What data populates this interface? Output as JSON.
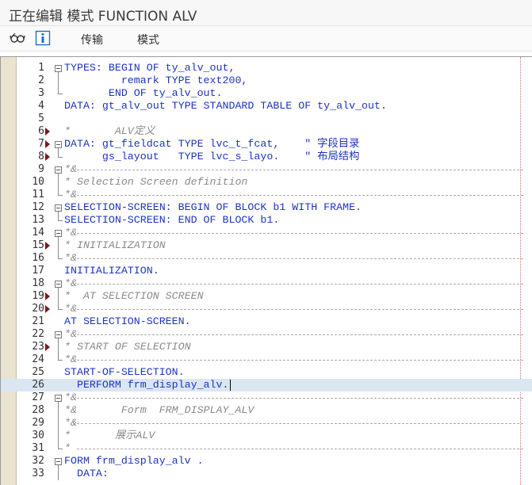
{
  "window": {
    "title": "正在编辑 模式 FUNCTION ALV"
  },
  "toolbar": {
    "icons": [
      "glasses-icon",
      "info-icon"
    ],
    "transport_label": "传输",
    "mode_label": "模式"
  },
  "editor": {
    "lines": [
      {
        "n": "1",
        "text": "TYPES: BEGIN OF ty_alv_out,",
        "cls": "keyword",
        "fold": "start"
      },
      {
        "n": "2",
        "text": "         remark TYPE text200,",
        "cls": "keyword",
        "fold": "mid"
      },
      {
        "n": "3",
        "text": "       END OF ty_alv_out.",
        "cls": "keyword",
        "fold": "end"
      },
      {
        "n": "4",
        "text": "DATA: gt_alv_out TYPE STANDARD TABLE OF ty_alv_out.",
        "cls": "keyword"
      },
      {
        "n": "5",
        "text": ""
      },
      {
        "n": "6",
        "text": "*       ALV定义",
        "cls": "comment",
        "mark": true
      },
      {
        "n": "7",
        "text": "DATA: gt_fieldcat TYPE lvc_t_fcat,    \" 字段目录",
        "cls": "keyword",
        "mark": true,
        "fold": "start"
      },
      {
        "n": "8",
        "text": "      gs_layout   TYPE lvc_s_layo.    \" 布局结构",
        "cls": "keyword",
        "mark": true,
        "fold": "end"
      },
      {
        "n": "9",
        "text": "*&",
        "cls": "comment",
        "dashed": true,
        "fold": "start"
      },
      {
        "n": "10",
        "text": "* Selection Screen definition",
        "cls": "comment",
        "fold": "mid"
      },
      {
        "n": "11",
        "text": "*&",
        "cls": "comment",
        "dashed": true,
        "fold": "end"
      },
      {
        "n": "12",
        "text": "SELECTION-SCREEN: BEGIN OF BLOCK b1 WITH FRAME.",
        "cls": "keyword",
        "fold": "start"
      },
      {
        "n": "13",
        "text": "SELECTION-SCREEN: END OF BLOCK b1.",
        "cls": "keyword",
        "fold": "end"
      },
      {
        "n": "14",
        "text": "*&",
        "cls": "comment",
        "dashed": true,
        "fold": "start"
      },
      {
        "n": "15",
        "text": "* INITIALIZATION",
        "cls": "comment",
        "mark": true,
        "fold": "mid"
      },
      {
        "n": "16",
        "text": "*&",
        "cls": "comment",
        "dashed": true,
        "fold": "end"
      },
      {
        "n": "17",
        "text": "INITIALIZATION.",
        "cls": "keyword"
      },
      {
        "n": "18",
        "text": "*&",
        "cls": "comment",
        "dashed": true,
        "fold": "start"
      },
      {
        "n": "19",
        "text": "*  AT SELECTION SCREEN",
        "cls": "comment",
        "mark": true,
        "fold": "mid"
      },
      {
        "n": "20",
        "text": "*&",
        "cls": "comment",
        "dashed": true,
        "mark": true,
        "fold": "end"
      },
      {
        "n": "21",
        "text": "AT SELECTION-SCREEN.",
        "cls": "keyword"
      },
      {
        "n": "22",
        "text": "*&",
        "cls": "comment",
        "dashed": true,
        "fold": "start"
      },
      {
        "n": "23",
        "text": "* START OF SELECTION",
        "cls": "comment",
        "mark": true,
        "fold": "mid"
      },
      {
        "n": "24",
        "text": "*&",
        "cls": "comment",
        "dashed": true,
        "fold": "end"
      },
      {
        "n": "25",
        "text": "START-OF-SELECTION.",
        "cls": "keyword"
      },
      {
        "n": "26",
        "text": "  PERFORM frm_display_alv.",
        "cls": "keyword",
        "highlight": true,
        "caret": true
      },
      {
        "n": "27",
        "text": "*&",
        "cls": "comment",
        "dashed": true,
        "fold": "start"
      },
      {
        "n": "28",
        "text": "*&       Form  FRM_DISPLAY_ALV",
        "cls": "comment",
        "fold": "mid"
      },
      {
        "n": "29",
        "text": "*&",
        "cls": "comment",
        "dashed": true,
        "fold": "mid"
      },
      {
        "n": "30",
        "text": "*       展示ALV",
        "cls": "comment",
        "fold": "mid"
      },
      {
        "n": "31",
        "text": "*",
        "cls": "comment",
        "dashed": true,
        "fold": "end"
      },
      {
        "n": "32",
        "text": "FORM frm_display_alv .",
        "cls": "keyword",
        "fold": "start"
      },
      {
        "n": "33",
        "text": "  DATA:",
        "cls": "keyword",
        "fold": "mid"
      }
    ]
  }
}
